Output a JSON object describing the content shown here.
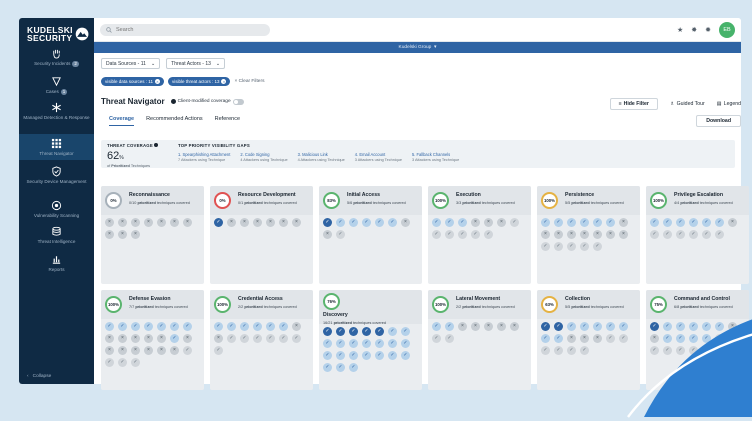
{
  "brand": {
    "line1": "KUDELSKI",
    "line2": "SECURITY"
  },
  "sidebar": {
    "items": [
      {
        "label": "Security Incidents",
        "badge": "2"
      },
      {
        "label": "Cases",
        "badge": "1"
      },
      {
        "label": "Managed Detection & Response",
        "badge": ""
      },
      {
        "label": "Threat Navigator",
        "badge": ""
      },
      {
        "label": "Security Device Management",
        "badge": ""
      },
      {
        "label": "Vulnerability Scanning",
        "badge": ""
      },
      {
        "label": "Threat Intelligence",
        "badge": ""
      },
      {
        "label": "Reports",
        "badge": ""
      }
    ],
    "collapse_label": "Collapse",
    "collapse_arrow": "‹"
  },
  "topbar": {
    "search_placeholder": "Search",
    "avatar_initials": "EB",
    "icons": [
      "star-icon",
      "notification-icon",
      "gear-icon"
    ]
  },
  "group_bar": {
    "label": "Kudelski Group",
    "caret": "▾"
  },
  "filters": {
    "data_sources": "Data Sources - 11",
    "threat_actors": "Threat Actors - 13",
    "caret": "⌄",
    "chip_sources": "visible data sources : 11",
    "chip_actors": "visible threat actors : 13",
    "chip_close": "×",
    "clear": "× Clear Filters"
  },
  "header": {
    "title": "Threat Navigator",
    "client_modified": "Client-modified coverage",
    "tabs": [
      "Coverage",
      "Recommended Actions",
      "Reference"
    ],
    "hide_filter": "Hide Filter",
    "guided_tour": "Guided Tour",
    "legend": "Legend",
    "download": "Download"
  },
  "coverage": {
    "title": "THREAT COVERAGE",
    "percent": "62",
    "percent_sign": "%",
    "sub_prefix": "of",
    "sub_strong": "Prioritized",
    "sub_suffix": "Techniques",
    "gaps_title": "TOP PRIORITY VISIBILITY GAPS",
    "gaps": [
      {
        "name": "1. Spearphishing Attachment",
        "sub": "7 Attackers using Technique"
      },
      {
        "name": "2. Code Signing",
        "sub": "4 Attackers using Technique"
      },
      {
        "name": "3. Malicious Link",
        "sub": "4 Attackers using Technique"
      },
      {
        "name": "4. Email Account",
        "sub": "3 Attackers using Technique"
      },
      {
        "name": "5. Fallback Channels",
        "sub": "3 Attackers using Technique"
      }
    ]
  },
  "tactics": [
    {
      "name": "Reconnaissance",
      "pct": "0%",
      "sub_pre": "0/10",
      "sub_b": "prioritized",
      "sub_post": "techniques covered",
      "ring": "#a7b1ba",
      "techs": [
        "x",
        "x",
        "x",
        "x",
        "x",
        "x",
        "x",
        "x",
        "x",
        "x"
      ]
    },
    {
      "name": "Resource Development",
      "pct": "0%",
      "sub_pre": "0/1",
      "sub_b": "prioritized",
      "sub_post": "techniques covered",
      "ring": "#e05252",
      "techs": [
        "dark",
        "x",
        "x",
        "x",
        "x",
        "x",
        "x"
      ]
    },
    {
      "name": "Initial Access",
      "pct": "83%",
      "sub_pre": "5/6",
      "sub_b": "prioritized",
      "sub_post": "techniques covered",
      "ring": "#5ab46e",
      "techs": [
        "dark",
        "ok",
        "ok",
        "ok",
        "ok",
        "ok",
        "x",
        "x",
        "c"
      ]
    },
    {
      "name": "Execution",
      "pct": "100%",
      "sub_pre": "3/3",
      "sub_b": "prioritized",
      "sub_post": "techniques covered",
      "ring": "#5ab46e",
      "techs": [
        "ok",
        "ok",
        "ok",
        "x",
        "x",
        "x",
        "c",
        "c",
        "c",
        "c",
        "c",
        "c"
      ]
    },
    {
      "name": "Persistence",
      "pct": "100%",
      "sub_pre": "5/5",
      "sub_b": "prioritized",
      "sub_post": "techniques covered",
      "ring": "#e5b243",
      "techs": [
        "ok",
        "ok",
        "ok",
        "ok",
        "ok",
        "ok",
        "x",
        "x",
        "x",
        "x",
        "x",
        "x",
        "x",
        "x",
        "c",
        "c",
        "c",
        "c",
        "c"
      ]
    },
    {
      "name": "Privilege Escalation",
      "pct": "100%",
      "sub_pre": "4/4",
      "sub_b": "prioritized",
      "sub_post": "techniques covered",
      "ring": "#5ab46e",
      "techs": [
        "ok",
        "ok",
        "ok",
        "ok",
        "ok",
        "ok",
        "x",
        "c",
        "c",
        "c",
        "c",
        "c",
        "c"
      ]
    },
    {
      "name": "Defense Evasion",
      "pct": "100%",
      "sub_pre": "7/7",
      "sub_b": "prioritized",
      "sub_post": "techniques covered",
      "ring": "#5ab46e",
      "techs": [
        "ok",
        "ok",
        "ok",
        "ok",
        "ok",
        "ok",
        "ok",
        "x",
        "x",
        "x",
        "x",
        "x",
        "ok",
        "x",
        "x",
        "x",
        "x",
        "x",
        "x",
        "x",
        "c",
        "c",
        "c",
        "c"
      ]
    },
    {
      "name": "Credential Access",
      "pct": "100%",
      "sub_pre": "2/2",
      "sub_b": "prioritized",
      "sub_post": "techniques covered",
      "ring": "#5ab46e",
      "techs": [
        "ok",
        "ok",
        "ok",
        "ok",
        "ok",
        "ok",
        "x",
        "x",
        "c",
        "c",
        "c",
        "c",
        "c",
        "c",
        "c"
      ]
    },
    {
      "name": "Discovery",
      "pct": "76%",
      "sub_pre": "16/21",
      "sub_b": "prioritized",
      "sub_post": "techniques covered",
      "ring": "#5ab46e",
      "techs": [
        "dark",
        "dark",
        "dark",
        "dark",
        "dark",
        "ok",
        "ok",
        "ok",
        "ok",
        "ok",
        "ok",
        "ok",
        "ok",
        "ok",
        "ok",
        "ok",
        "ok",
        "ok",
        "ok",
        "ok",
        "ok",
        "ok",
        "ok",
        "ok"
      ]
    },
    {
      "name": "Lateral Movement",
      "pct": "100%",
      "sub_pre": "2/2",
      "sub_b": "prioritized",
      "sub_post": "techniques covered",
      "ring": "#5ab46e",
      "techs": [
        "ok",
        "ok",
        "x",
        "x",
        "x",
        "x",
        "x",
        "c",
        "c"
      ]
    },
    {
      "name": "Collection",
      "pct": "63%",
      "sub_pre": "5/5",
      "sub_b": "prioritized",
      "sub_post": "techniques covered",
      "ring": "#e5b243",
      "techs": [
        "dark",
        "dark",
        "ok",
        "ok",
        "ok",
        "ok",
        "ok",
        "ok",
        "ok",
        "x",
        "x",
        "x",
        "c",
        "c",
        "c",
        "c",
        "c",
        "c"
      ]
    },
    {
      "name": "Command and Control",
      "pct": "75%",
      "sub_pre": "6/8",
      "sub_b": "prioritized",
      "sub_post": "techniques covered",
      "ring": "#5ab46e",
      "techs": [
        "dark",
        "ok",
        "ok",
        "ok",
        "ok",
        "ok",
        "x",
        "x",
        "ok",
        "ok",
        "ok",
        "ok",
        "c",
        "c",
        "c",
        "c",
        "c",
        "c"
      ]
    }
  ],
  "colors": {
    "sidebar": "#0f2a44",
    "accent": "#2f64a4",
    "good": "#5ab46e",
    "warn": "#e5b243",
    "bad": "#e05252"
  }
}
